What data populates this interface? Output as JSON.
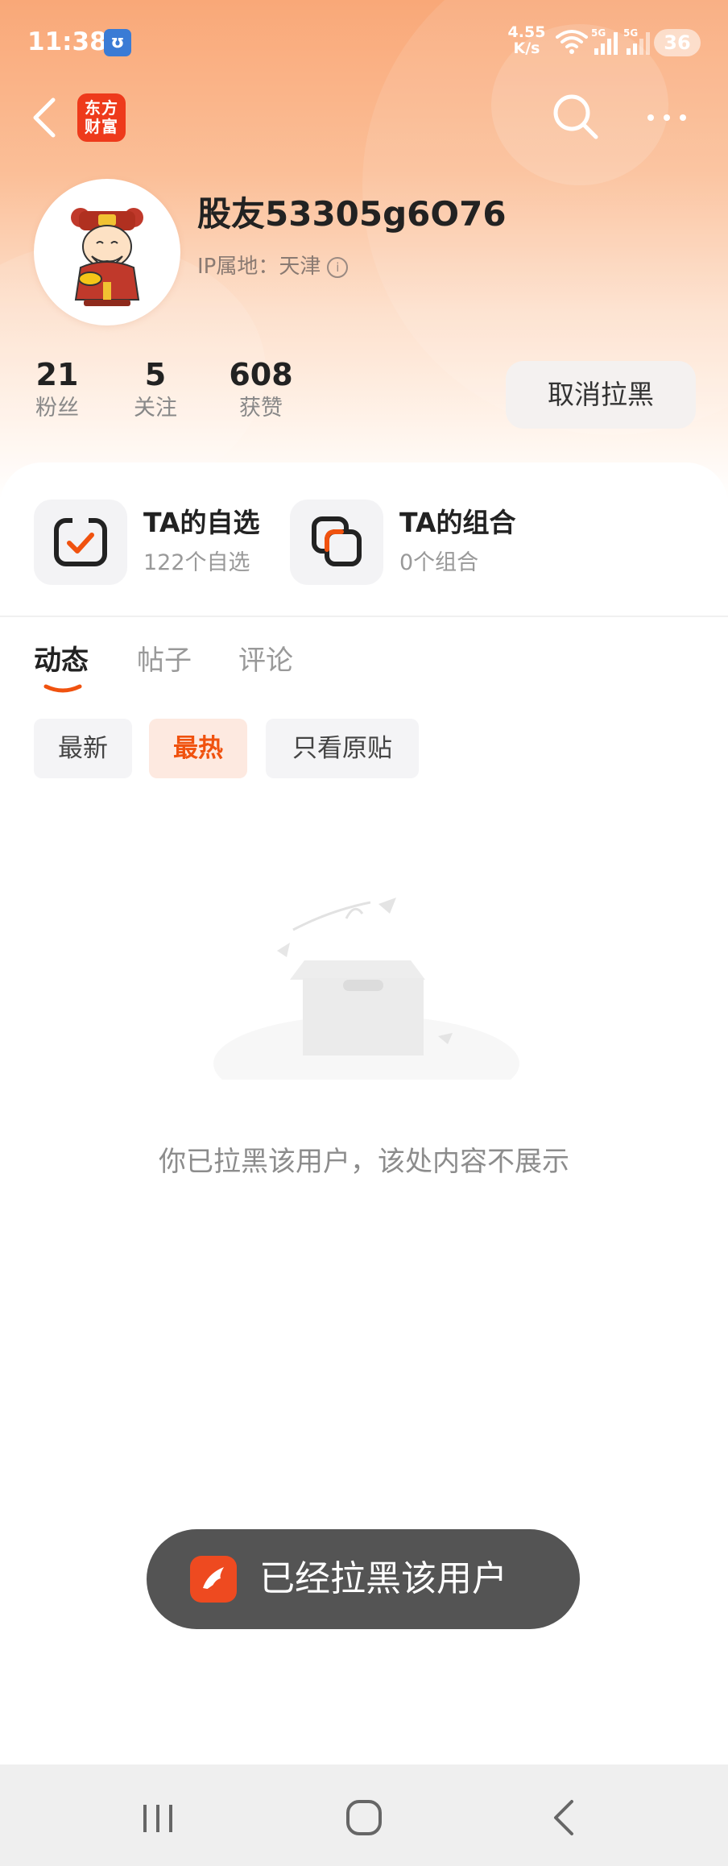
{
  "status_bar": {
    "time": "11:38",
    "app_badge": "ʊ",
    "net_speed_value": "4.55",
    "net_speed_unit": "K/s",
    "net1": "5G",
    "net2": "5G",
    "battery": "36"
  },
  "header": {
    "logo_text_line1": "东方",
    "logo_text_line2": "财富",
    "icons": [
      "back-icon",
      "search-icon",
      "more-icon"
    ]
  },
  "profile": {
    "username": "股友53305g6O76",
    "ip_label": "IP属地：天津",
    "stats": [
      {
        "value": "21",
        "label": "粉丝"
      },
      {
        "value": "5",
        "label": "关注"
      },
      {
        "value": "608",
        "label": "获赞"
      }
    ],
    "action_button": "取消拉黑"
  },
  "features": [
    {
      "title": "TA的自选",
      "subtitle": "122个自选",
      "icon": "watchlist-icon"
    },
    {
      "title": "TA的组合",
      "subtitle": "0个组合",
      "icon": "portfolio-icon"
    }
  ],
  "tabs": [
    {
      "label": "动态",
      "active": true
    },
    {
      "label": "帖子",
      "active": false
    },
    {
      "label": "评论",
      "active": false
    }
  ],
  "filters": [
    {
      "label": "最新",
      "active": false
    },
    {
      "label": "最热",
      "active": true
    },
    {
      "label": "只看原贴",
      "active": false
    }
  ],
  "empty_state": {
    "message": "你已拉黑该用户，该处内容不展示"
  },
  "toast": {
    "message": "已经拉黑该用户"
  },
  "colors": {
    "accent": "#f0520f",
    "header_gradient_top": "#f9a878",
    "toast_bg": "#545454",
    "logo_red": "#ee3a1b"
  }
}
